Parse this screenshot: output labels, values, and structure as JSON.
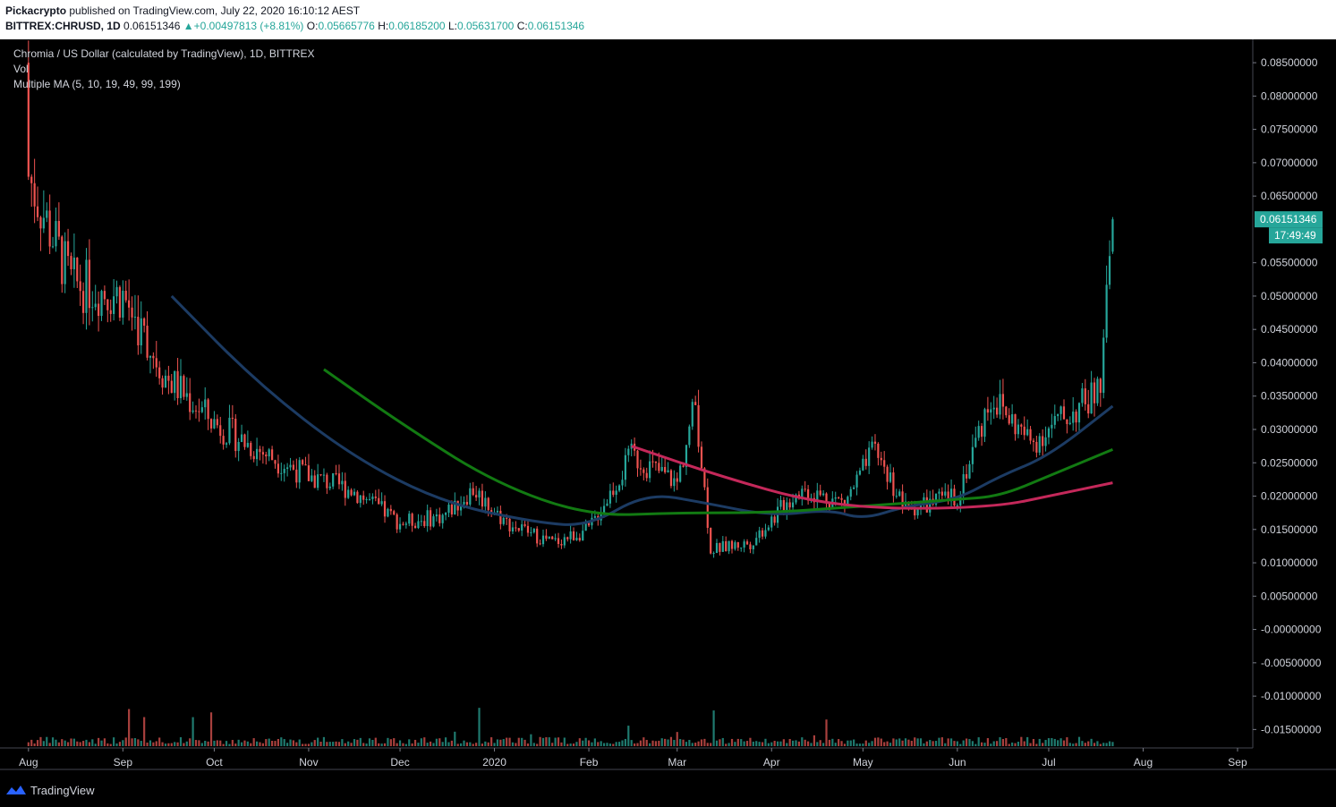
{
  "header": {
    "author": "Pickacrypto",
    "published_text": " published on TradingView.com, July 22, 2020 16:10:12 AEST",
    "symbol": "BITTREX:CHRUSD, 1D",
    "last": "0.06151346",
    "change": "+0.00497813 (+8.81%)",
    "o_label": "O:",
    "o_value": "0.05665776",
    "h_label": "H:",
    "h_value": "0.06185200",
    "l_label": "L:",
    "l_value": "0.05631700",
    "c_label": "C:",
    "c_value": "0.06151346"
  },
  "legend": {
    "title": "Chromia / US Dollar (calculated by TradingView), 1D, BITTREX",
    "vol": "Vol",
    "ma": "Multiple MA (5, 10, 19, 49, 99, 199)"
  },
  "price_badge": {
    "price": "0.06151346",
    "countdown": "17:49:49"
  },
  "footer": {
    "brand": "TradingView"
  },
  "colors": {
    "up": "#26a69a",
    "down": "#ef5350",
    "vol_up": "#1f7a6f",
    "vol_down": "#a8403d",
    "ma49": "#1c3b63",
    "ma99": "#127a12",
    "ma199": "#c4285a",
    "grid": "#2a2e39",
    "axis_text": "#d1d4dc"
  },
  "chart_data": {
    "type": "candlestick",
    "x_ticks": [
      "Aug",
      "Sep",
      "Oct",
      "Nov",
      "Dec",
      "2020",
      "Feb",
      "Mar",
      "Apr",
      "May",
      "Jun",
      "Jul",
      "Aug",
      "Sep"
    ],
    "y_ticks": [
      "0.08500000",
      "0.08000000",
      "0.07500000",
      "0.07000000",
      "0.06500000",
      "0.05500000",
      "0.05000000",
      "0.04500000",
      "0.04000000",
      "0.03500000",
      "0.03000000",
      "0.02500000",
      "0.02000000",
      "0.01500000",
      "0.01000000",
      "0.00500000",
      "-0.00000000",
      "-0.00500000",
      "-0.01000000",
      "-0.01500000"
    ],
    "y_tick_values": [
      0.085,
      0.08,
      0.075,
      0.07,
      0.065,
      0.055,
      0.05,
      0.045,
      0.04,
      0.035,
      0.03,
      0.025,
      0.02,
      0.015,
      0.01,
      0.005,
      0.0,
      -0.005,
      -0.01,
      -0.015
    ],
    "ylim": [
      -0.0175,
      0.0885
    ],
    "key_closes": [
      {
        "date": "2019-08-01",
        "close": 0.068
      },
      {
        "date": "2019-08-15",
        "close": 0.052
      },
      {
        "date": "2019-09-01",
        "close": 0.05
      },
      {
        "date": "2019-09-15",
        "close": 0.038
      },
      {
        "date": "2019-10-01",
        "close": 0.031
      },
      {
        "date": "2019-10-15",
        "close": 0.027
      },
      {
        "date": "2019-11-01",
        "close": 0.023
      },
      {
        "date": "2019-11-15",
        "close": 0.021
      },
      {
        "date": "2019-12-01",
        "close": 0.016
      },
      {
        "date": "2019-12-15",
        "close": 0.017
      },
      {
        "date": "2019-12-25",
        "close": 0.021
      },
      {
        "date": "2020-01-05",
        "close": 0.016
      },
      {
        "date": "2020-01-20",
        "close": 0.013
      },
      {
        "date": "2020-02-01",
        "close": 0.015
      },
      {
        "date": "2020-02-15",
        "close": 0.026
      },
      {
        "date": "2020-03-01",
        "close": 0.022
      },
      {
        "date": "2020-03-07",
        "close": 0.034
      },
      {
        "date": "2020-03-12",
        "close": 0.012
      },
      {
        "date": "2020-03-25",
        "close": 0.013
      },
      {
        "date": "2020-04-10",
        "close": 0.021
      },
      {
        "date": "2020-04-25",
        "close": 0.019
      },
      {
        "date": "2020-05-05",
        "close": 0.027
      },
      {
        "date": "2020-05-15",
        "close": 0.018
      },
      {
        "date": "2020-06-01",
        "close": 0.02
      },
      {
        "date": "2020-06-12",
        "close": 0.035
      },
      {
        "date": "2020-06-25",
        "close": 0.028
      },
      {
        "date": "2020-07-10",
        "close": 0.033
      },
      {
        "date": "2020-07-18",
        "close": 0.036
      },
      {
        "date": "2020-07-22",
        "close": 0.0615
      }
    ],
    "ma_series": [
      {
        "period": 49,
        "points": [
          [
            "2019-09-17",
            0.05
          ],
          [
            "2019-10-15",
            0.037
          ],
          [
            "2019-11-15",
            0.026
          ],
          [
            "2019-12-15",
            0.019
          ],
          [
            "2020-01-15",
            0.016
          ],
          [
            "2020-02-01",
            0.0155
          ],
          [
            "2020-02-20",
            0.0205
          ],
          [
            "2020-03-10",
            0.019
          ],
          [
            "2020-04-01",
            0.017
          ],
          [
            "2020-04-20",
            0.018
          ],
          [
            "2020-05-01",
            0.0165
          ],
          [
            "2020-05-15",
            0.0185
          ],
          [
            "2020-06-01",
            0.0195
          ],
          [
            "2020-06-15",
            0.023
          ],
          [
            "2020-07-01",
            0.026
          ],
          [
            "2020-07-22",
            0.0335
          ]
        ]
      },
      {
        "period": 99,
        "points": [
          [
            "2019-11-06",
            0.039
          ],
          [
            "2019-12-01",
            0.031
          ],
          [
            "2020-01-01",
            0.022
          ],
          [
            "2020-02-01",
            0.017
          ],
          [
            "2020-03-01",
            0.0175
          ],
          [
            "2020-04-01",
            0.0175
          ],
          [
            "2020-05-01",
            0.0185
          ],
          [
            "2020-06-01",
            0.0195
          ],
          [
            "2020-06-15",
            0.02
          ],
          [
            "2020-07-01",
            0.023
          ],
          [
            "2020-07-22",
            0.027
          ]
        ]
      },
      {
        "period": 199,
        "points": [
          [
            "2020-02-15",
            0.0275
          ],
          [
            "2020-03-15",
            0.023
          ],
          [
            "2020-04-15",
            0.019
          ],
          [
            "2020-05-15",
            0.018
          ],
          [
            "2020-06-15",
            0.0185
          ],
          [
            "2020-07-01",
            0.02
          ],
          [
            "2020-07-22",
            0.022
          ]
        ]
      }
    ]
  }
}
